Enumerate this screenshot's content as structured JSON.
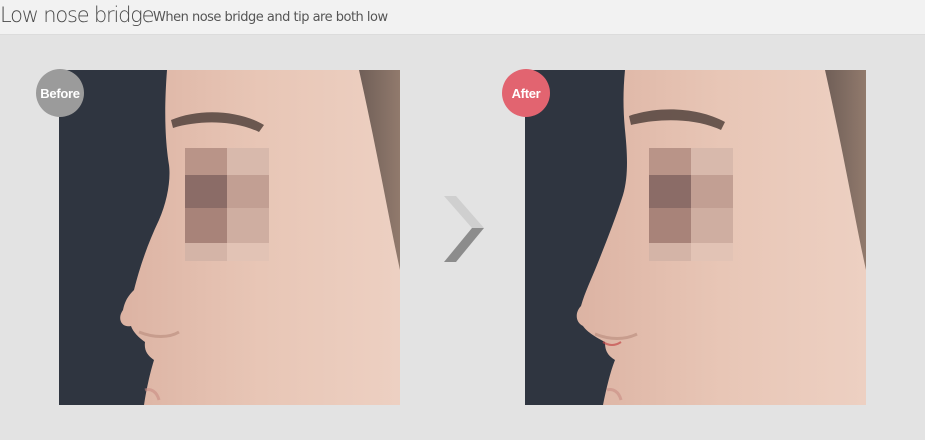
{
  "header": {
    "title": "Low nose bridge",
    "subtitle": "When nose bridge and tip are both low"
  },
  "before": {
    "label": "Before"
  },
  "after": {
    "label": "After"
  },
  "colors": {
    "background": "#e3e3e3",
    "before_badge": "#9b9b9b",
    "after_badge": "#e26470",
    "photo_backdrop": "#2f3540",
    "skin": "#e6c2b2",
    "arrow": "#8c8c8c"
  },
  "icons": {
    "arrow": "chevron-right-icon"
  }
}
